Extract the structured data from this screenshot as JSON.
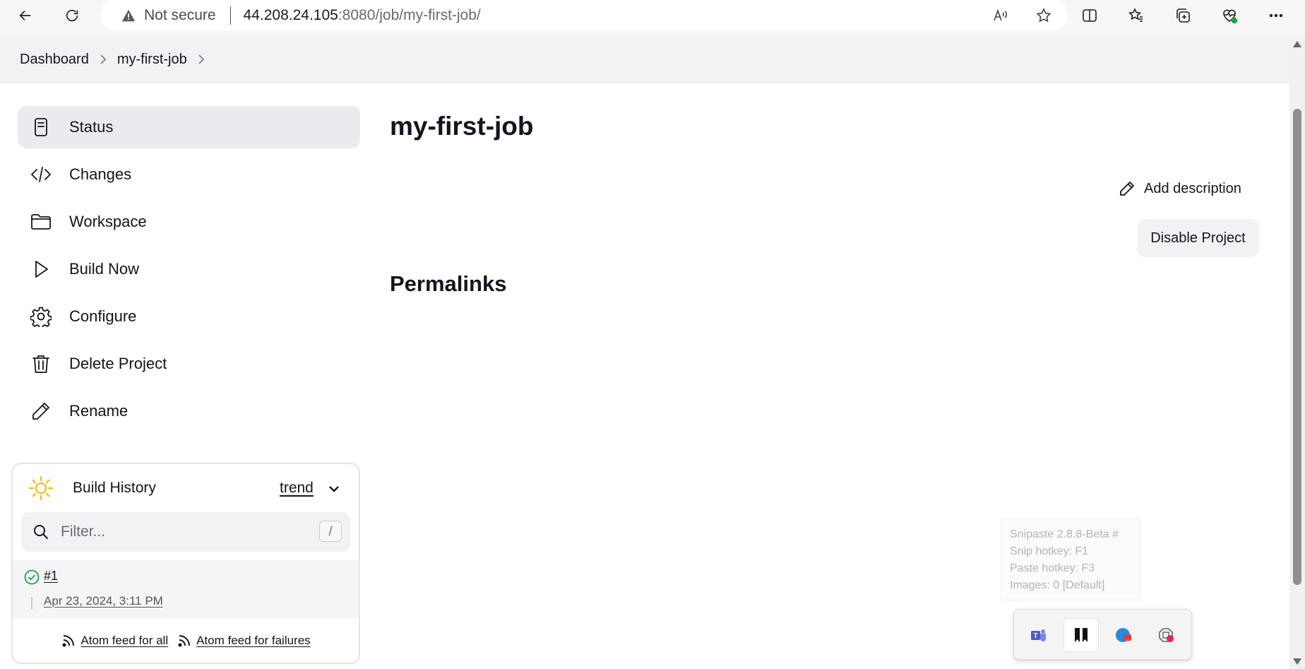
{
  "browser": {
    "not_secure": "Not secure",
    "url_host": "44.208.24.105",
    "url_path": ":8080/job/my-first-job/"
  },
  "breadcrumb": [
    "Dashboard",
    "my-first-job"
  ],
  "sidebar": {
    "items": [
      {
        "label": "Status",
        "icon": "status-icon"
      },
      {
        "label": "Changes",
        "icon": "code-icon"
      },
      {
        "label": "Workspace",
        "icon": "folder-icon"
      },
      {
        "label": "Build Now",
        "icon": "play-icon"
      },
      {
        "label": "Configure",
        "icon": "gear-icon"
      },
      {
        "label": "Delete Project",
        "icon": "trash-icon"
      },
      {
        "label": "Rename",
        "icon": "pencil-icon"
      }
    ]
  },
  "build_history": {
    "title": "Build History",
    "trend": "trend",
    "filter_placeholder": "Filter...",
    "shortcut": "/",
    "builds": [
      {
        "number": "#1",
        "date": "Apr 23, 2024, 3:11 PM",
        "status": "success"
      }
    ],
    "feed_all": "Atom feed for all",
    "feed_failures": "Atom feed for failures"
  },
  "main": {
    "title": "my-first-job",
    "add_description": "Add description",
    "disable_project": "Disable Project",
    "permalinks": "Permalinks"
  },
  "snipaste": {
    "lines": [
      "Snipaste 2.8.8-Beta #",
      "Snip hotkey: F1",
      "Paste hotkey: F3",
      "Images: 0 [Default]"
    ]
  },
  "colors": {
    "accent_success": "#1ea446",
    "sun": "#f2b705"
  }
}
